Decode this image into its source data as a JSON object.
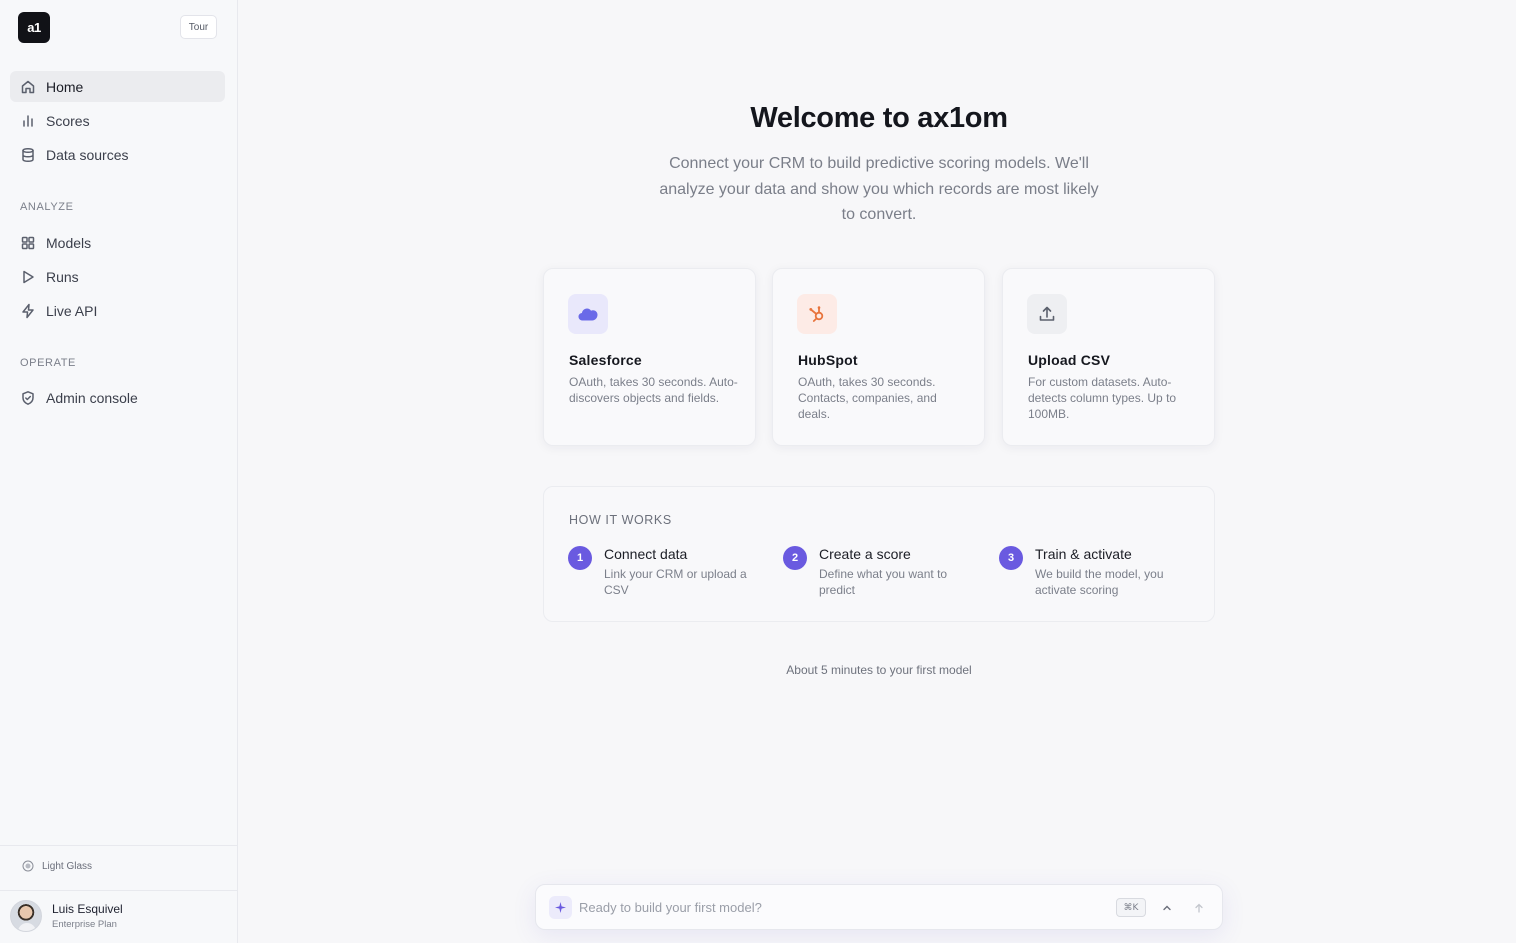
{
  "app": {
    "logo_text": "a1",
    "tour_label": "Tour"
  },
  "sidebar": {
    "primary": [
      {
        "label": "Home",
        "icon": "home-icon",
        "active": true
      },
      {
        "label": "Scores",
        "icon": "bar-chart-icon",
        "active": false
      },
      {
        "label": "Data sources",
        "icon": "database-icon",
        "active": false
      }
    ],
    "analyze_label": "ANALYZE",
    "analyze": [
      {
        "label": "Models",
        "icon": "grid-icon"
      },
      {
        "label": "Runs",
        "icon": "play-icon"
      },
      {
        "label": "Live API",
        "icon": "bolt-icon"
      }
    ],
    "operate_label": "OPERATE",
    "operate": [
      {
        "label": "Admin console",
        "icon": "shield-icon"
      }
    ],
    "theme_label": "Light Glass",
    "user": {
      "name": "Luis Esquivel",
      "plan": "Enterprise Plan"
    }
  },
  "main": {
    "title": "Welcome to ax1om",
    "subtitle": "Connect your CRM to build predictive scoring models. We'll analyze your data and show you which records are most likely to convert.",
    "cards": [
      {
        "title": "Salesforce",
        "desc": "OAuth, takes 30 seconds. Auto-discovers objects and fields.",
        "icon": "salesforce-cloud-icon"
      },
      {
        "title": "HubSpot",
        "desc": "OAuth, takes 30 seconds. Contacts, companies, and deals.",
        "icon": "hubspot-icon"
      },
      {
        "title": "Upload CSV",
        "desc": "For custom datasets. Auto-detects column types. Up to 100MB.",
        "icon": "upload-icon"
      }
    ],
    "how_it_works": {
      "label": "HOW IT WORKS",
      "steps": [
        {
          "num": "1",
          "title": "Connect data",
          "desc": "Link your CRM or upload a CSV"
        },
        {
          "num": "2",
          "title": "Create a score",
          "desc": "Define what you want to predict"
        },
        {
          "num": "3",
          "title": "Train & activate",
          "desc": "We build the model, you activate scoring"
        }
      ]
    },
    "footnote": "About 5 minutes to your first model"
  },
  "prompt": {
    "placeholder": "Ready to build your first model?",
    "shortcut": "⌘K"
  },
  "colors": {
    "accent": "#6a5ae0",
    "salesforce_bg": "#e9e8fb",
    "salesforce_icon": "#6a6ae8",
    "hubspot_bg": "#fdebe6",
    "hubspot_icon": "#e8743d",
    "upload_bg": "#eeeff2"
  }
}
